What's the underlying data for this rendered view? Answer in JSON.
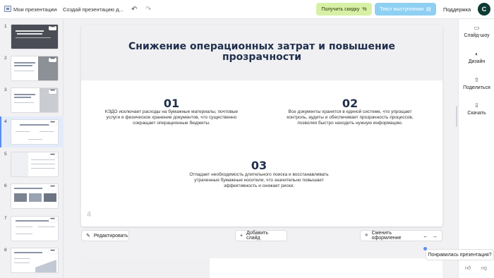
{
  "topbar": {
    "breadcrumb_root": "Мои презентации",
    "breadcrumb_current": "Создай презентацию д...",
    "discount_label": "Получить скидку",
    "speech_label": "Текст выступления",
    "support_label": "Поддержка",
    "avatar_letter": "C"
  },
  "thumbnails": [
    {
      "num": "1"
    },
    {
      "num": "2"
    },
    {
      "num": "3"
    },
    {
      "num": "4"
    },
    {
      "num": "5"
    },
    {
      "num": "6"
    },
    {
      "num": "7"
    },
    {
      "num": "8"
    }
  ],
  "slide": {
    "title": "Снижение операционных затрат и повышение прозрачности",
    "items": [
      {
        "num": "01",
        "text": "КЭДО исключает расходы на бумажные материалы, почтовые услуги и физическое хранение документов, что существенно сокращает операционные бюджеты."
      },
      {
        "num": "02",
        "text": "Все документы хранятся в единой системе, что упрощает контроль, аудиты и обеспечивает прозрачность процессов, позволяя быстро находить нужную информацию."
      },
      {
        "num": "03",
        "text": "Отпадает необходимость длительного поиска и восстанавливать утраченные бумажные носители, что значительно повышает эффективность и снижает риски."
      }
    ],
    "page_number": "4"
  },
  "slide_actions": {
    "edit_label": "Редактировать",
    "add_label": "Добавить слайд",
    "design_label": "Сменить оформление"
  },
  "right_panel": {
    "slideshow": "Слайд-шоу",
    "design": "Дизайн",
    "share": "Поделиться",
    "download": "Скачать"
  },
  "feedback": {
    "question": "Понравилась презентация?"
  },
  "colors": {
    "accent": "#5b8def",
    "title_color": "#1f2f4d",
    "discount_bg": "#d7f0a6",
    "speech_bg": "#8fd0f2",
    "avatar_bg": "#0e3b34"
  }
}
